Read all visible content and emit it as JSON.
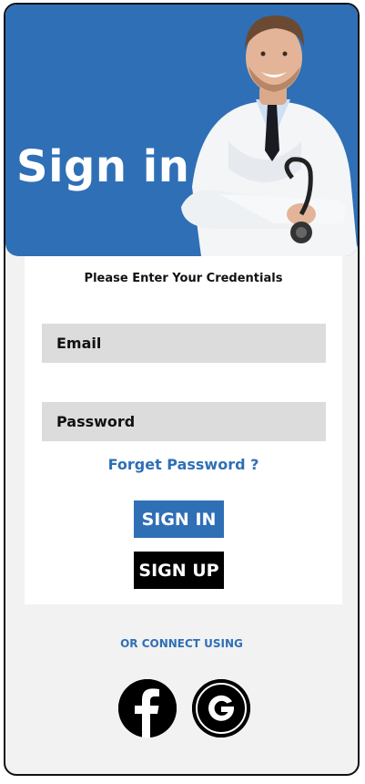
{
  "hero": {
    "title": "Sign in"
  },
  "form": {
    "subtitle": "Please Enter Your Credentials",
    "email_placeholder": "Email",
    "password_placeholder": "Password",
    "forgot_label": "Forget Password ?",
    "signin_label": "SIGN IN",
    "signup_label": "SIGN UP"
  },
  "social": {
    "connect_label": "OR CONNECT USING",
    "providers": [
      "facebook-icon",
      "google-icon"
    ]
  },
  "colors": {
    "accent": "#2f6fb6",
    "field_bg": "#dcdcdc",
    "page_bg": "#f2f2f2",
    "dark": "#000000"
  }
}
